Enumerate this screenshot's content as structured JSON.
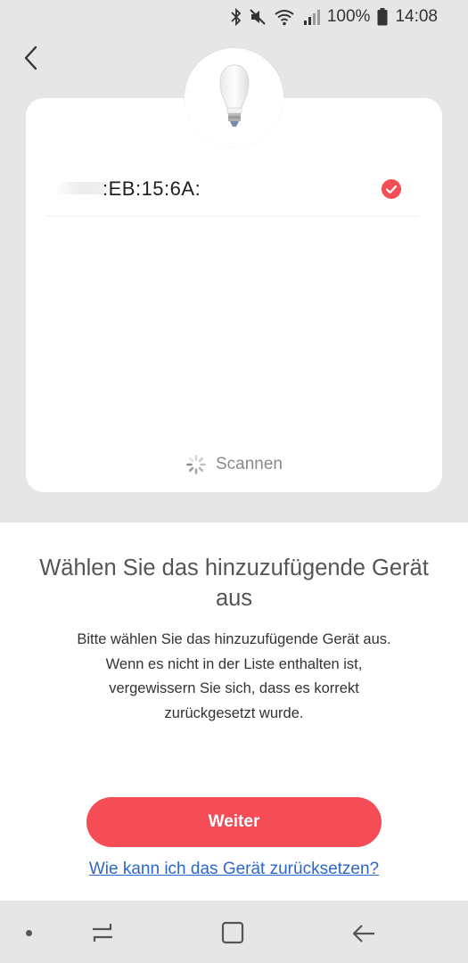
{
  "status_bar": {
    "battery_text": "100%",
    "time": "14:08",
    "icons": [
      "bluetooth-icon",
      "mute-icon",
      "wifi-icon",
      "signal-icon",
      "battery-icon"
    ]
  },
  "device_list": {
    "items": [
      {
        "name": ":EB:15:6A:",
        "selected": true
      }
    ],
    "scanning_label": "Scannen"
  },
  "info": {
    "title": "Wählen Sie das hinzuzufügende Gerät aus",
    "description": "Bitte wählen Sie das hinzuzufügende Gerät aus. Wenn es nicht in der Liste enthalten ist, vergewissern Sie sich, dass es korrekt zurückgesetzt wurde."
  },
  "actions": {
    "next_label": "Weiter",
    "help_link": "Wie kann ich das Gerät zurücksetzen?"
  },
  "colors": {
    "accent": "#f54d55",
    "link": "#2c67c9",
    "background": "#e6e6e6"
  }
}
